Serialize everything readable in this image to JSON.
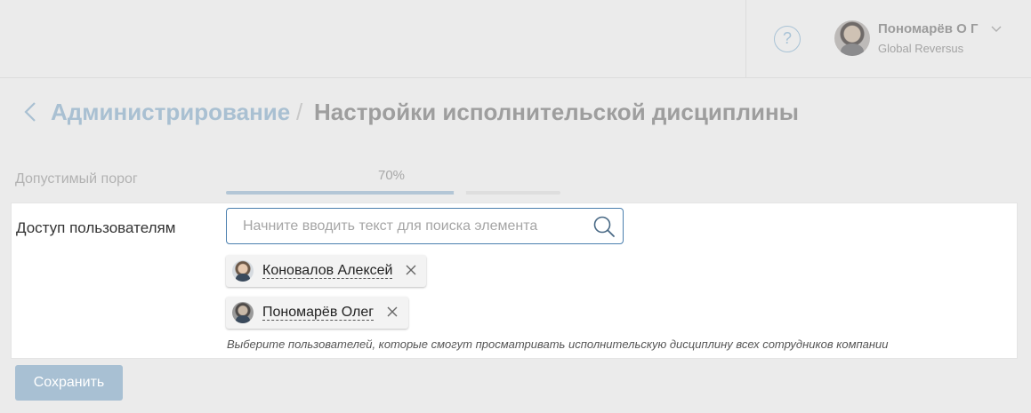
{
  "header": {
    "help_icon": "question-circle-icon",
    "help_glyph": "?",
    "user": {
      "name": "Пономарёв О Г",
      "company": "Global Reversus",
      "dropdown_icon": "chevron-down-icon"
    }
  },
  "breadcrumb": {
    "back_icon": "chevron-left-icon",
    "parent": "Администрирование",
    "separator": "/",
    "current": "Настройки исполнительской дисциплины"
  },
  "threshold": {
    "label": "Допустимый порог",
    "value_text": "70%",
    "value": 0.7
  },
  "access": {
    "label": "Доступ пользователям",
    "search_placeholder": "Начните вводить текст для поиска элемента",
    "search_value": "",
    "search_icon": "search-icon",
    "selected_users": [
      {
        "name": "Коновалов Алексей"
      },
      {
        "name": "Пономарёв Олег"
      }
    ],
    "hint": "Выберите пользователей, которые смогут просматривать исполнительскую дисциплину всех сотрудников компании"
  },
  "save_label": "Сохранить",
  "colors": {
    "background": "#ebebeb",
    "accent": "#a8c0d3",
    "search_border": "#4a7fae"
  }
}
